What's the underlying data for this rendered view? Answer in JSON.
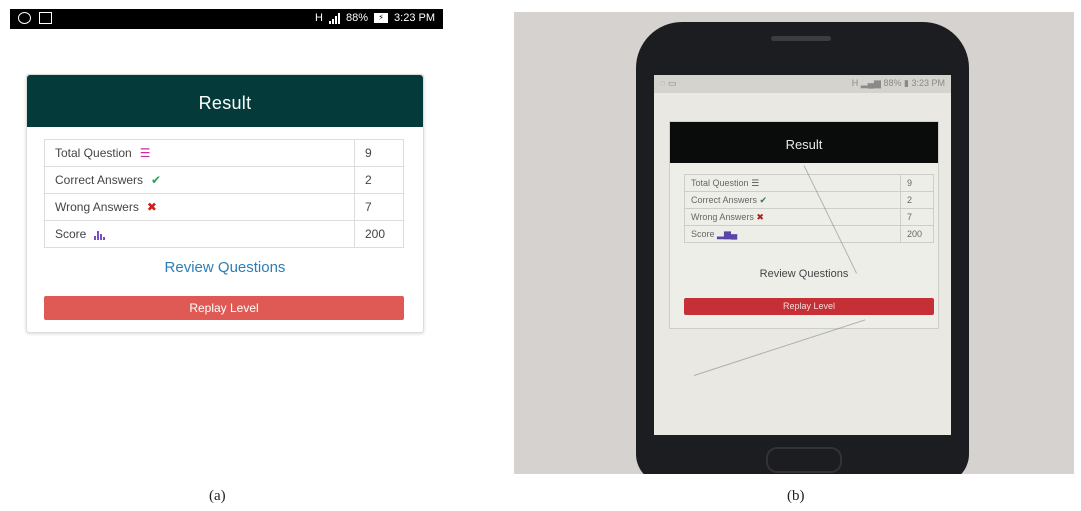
{
  "status_bar": {
    "time": "3:23 PM",
    "battery": "88%",
    "network": "H"
  },
  "result": {
    "title": "Result",
    "rows": [
      {
        "label": "Total Question",
        "icon": "list-icon",
        "value": "9"
      },
      {
        "label": "Correct Answers",
        "icon": "check-icon",
        "value": "2"
      },
      {
        "label": "Wrong Answers",
        "icon": "cross-icon",
        "value": "7"
      },
      {
        "label": "Score",
        "icon": "bar-chart-icon",
        "value": "200"
      }
    ],
    "review_link": "Review Questions",
    "replay_button": "Replay Level"
  },
  "captions": {
    "a": "(a)",
    "b": "(b)"
  },
  "colors": {
    "header": "#043a3a",
    "replay": "#df5a55",
    "link": "#2e7db6",
    "check": "#2e9e54",
    "cross": "#cc1f1f",
    "list": "#c2309b",
    "chart": "#7b4bc4"
  }
}
